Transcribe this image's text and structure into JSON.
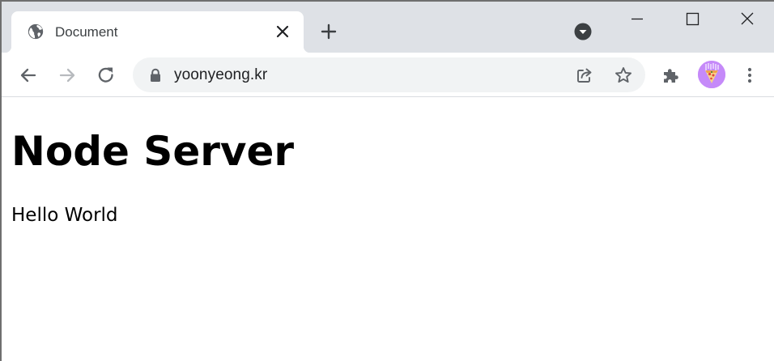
{
  "browser": {
    "tab": {
      "title": "Document",
      "favicon_icon": "globe-icon",
      "close_icon": "close-icon"
    },
    "new_tab_icon": "plus-icon",
    "tab_search_icon": "chevron-down-circle-icon",
    "window_controls": [
      "minimize-icon",
      "maximize-icon",
      "close-icon"
    ],
    "toolbar": {
      "back_icon": "arrow-left-icon",
      "forward_icon": "arrow-right-icon",
      "reload_icon": "reload-icon",
      "lock_icon": "lock-icon",
      "url": "yoonyeong.kr",
      "share_icon": "share-icon",
      "bookmark_icon": "star-icon",
      "extensions_icon": "puzzle-icon",
      "profile_icon": "avatar",
      "menu_icon": "kebab-menu-icon"
    },
    "colors": {
      "tabstrip": "#dee1e6",
      "omnibox": "#f1f3f4",
      "icon": "#5f6368",
      "avatar": "#c58af9"
    }
  },
  "page": {
    "heading": "Node Server",
    "text": "Hello World"
  }
}
